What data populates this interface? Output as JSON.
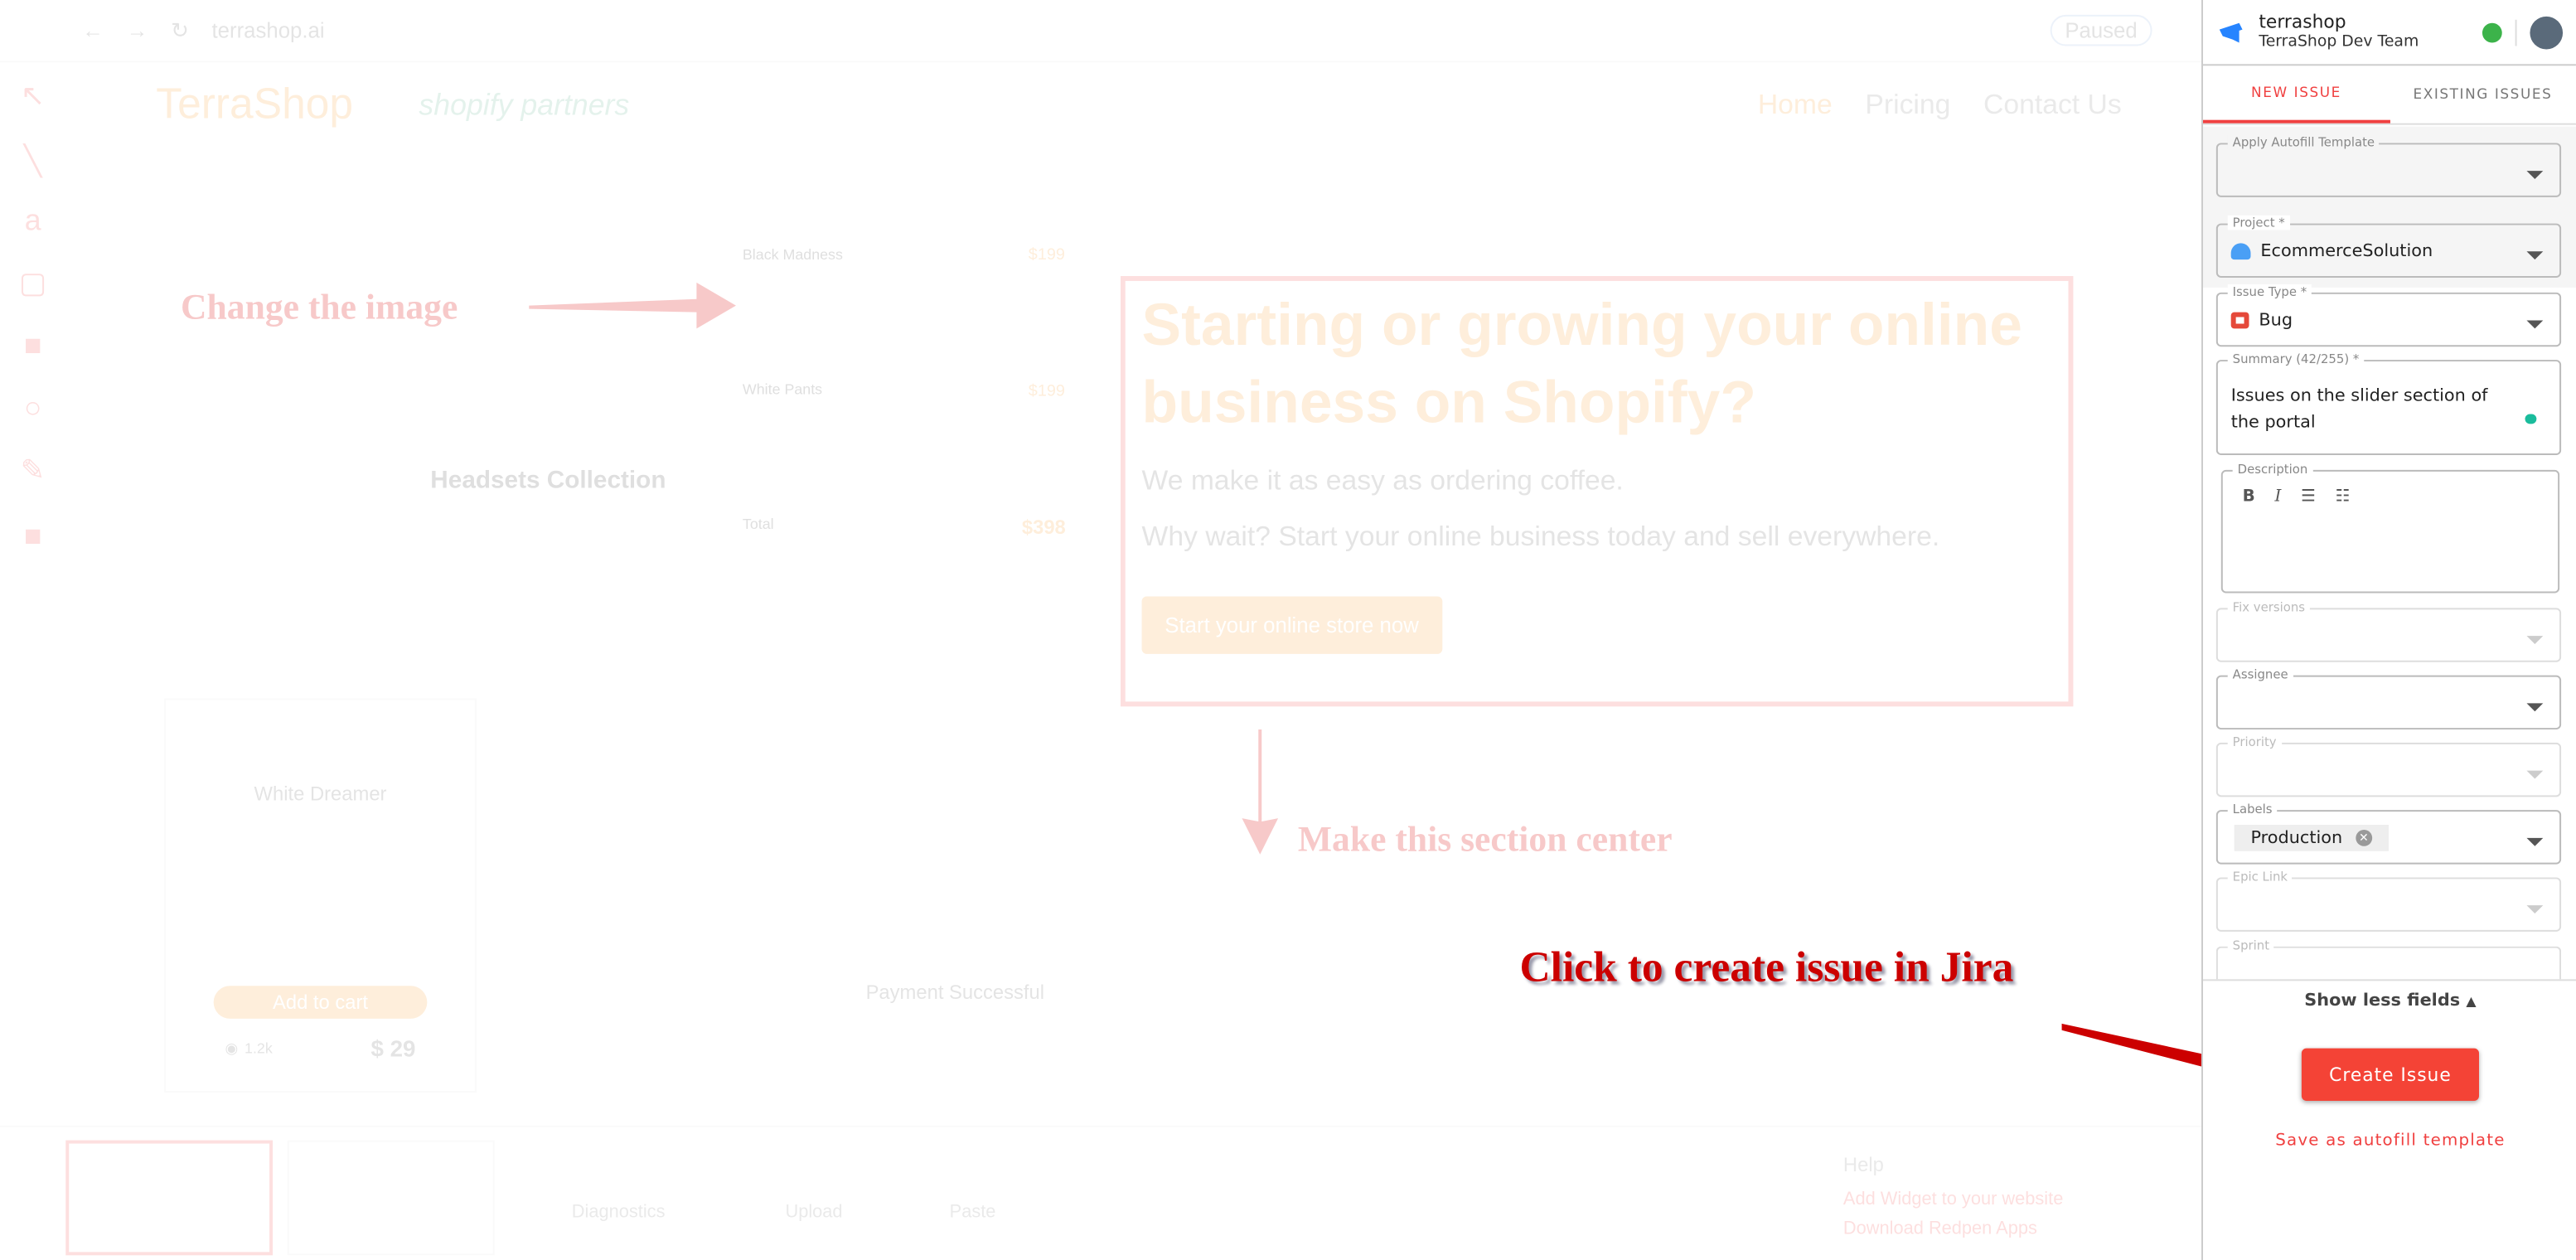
{
  "browser": {
    "url": "terrashop.ai",
    "profile": "Paused"
  },
  "site": {
    "logo": "TerraShop",
    "partner_logo": "shopify partners",
    "nav": [
      "Home",
      "Pricing",
      "Contact Us"
    ],
    "hero_title": "Starting or growing your online business on Shopify?",
    "hero_line1": "We make it as easy as ordering coffee.",
    "hero_line2": "Why wait? Start your online business today and sell everywhere.",
    "hero_cta": "Start your online store now",
    "collection_title": "Headsets Collection",
    "card_title": "White Dreamer",
    "card_btn": "Add to cart",
    "card_price": "$ 29",
    "card_views": "1.2k",
    "payment": "Payment Successful",
    "cart_items": [
      {
        "name": "Black Madness",
        "price": "$199"
      },
      {
        "name": "White Pants",
        "price": "$199"
      }
    ],
    "cart_total_label": "Total",
    "cart_total": "$398"
  },
  "annotations": {
    "change_image": "Change the image",
    "center_section": "Make this section center",
    "create_issue": "Click to create issue in Jira"
  },
  "bottom": {
    "diagnostics": "Diagnostics",
    "upload": "Upload",
    "paste": "Paste",
    "help": "Help",
    "help_link1": "Add Widget to your website",
    "help_link2": "Download Redpen Apps"
  },
  "panel": {
    "workspace": "terrashop",
    "team": "TerraShop Dev Team",
    "status_color": "#3cb34a",
    "tabs": {
      "new": "NEW ISSUE",
      "existing": "EXISTING ISSUES"
    },
    "fields": {
      "template": {
        "label": "Apply Autofill Template",
        "value": ""
      },
      "project": {
        "label": "Project *",
        "value": "EcommerceSolution"
      },
      "issue_type": {
        "label": "Issue Type *",
        "value": "Bug"
      },
      "summary": {
        "label": "Summary (42/255) *",
        "value": "Issues on the slider section of the portal"
      },
      "description": {
        "label": "Description",
        "value": ""
      },
      "fix_versions": {
        "label": "Fix versions"
      },
      "assignee": {
        "label": "Assignee"
      },
      "priority": {
        "label": "Priority"
      },
      "labels": {
        "label": "Labels",
        "chips": [
          "Production"
        ]
      },
      "epic_link": {
        "label": "Epic Link"
      },
      "sprint": {
        "label": "Sprint"
      }
    },
    "show_less": "Show less fields",
    "create": "Create Issue",
    "save_template": "Save as autofill template",
    "accent": "#f04040"
  }
}
